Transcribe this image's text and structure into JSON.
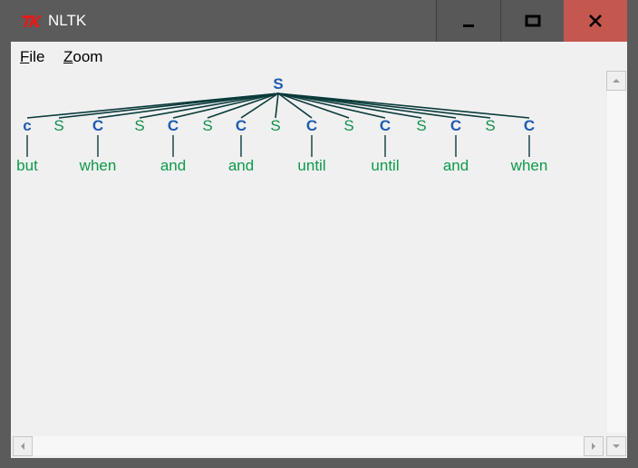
{
  "window": {
    "title": "NLTK",
    "title_color": "#ffffff",
    "titlebar_color": "#5b5b5b",
    "close_color": "#c4574e",
    "icons": [
      "tk-icon",
      "minimize-icon",
      "maximize-icon",
      "close-icon"
    ]
  },
  "menu": {
    "file_first": "F",
    "file_rest": "ile",
    "zoom_first": "Z",
    "zoom_rest": "oom"
  },
  "tree": {
    "root": "S",
    "children": [
      {
        "label": "c",
        "style": "blue",
        "leaf": "but"
      },
      {
        "label": "S",
        "style": "green",
        "leaf": null
      },
      {
        "label": "C",
        "style": "blue",
        "leaf": "when"
      },
      {
        "label": "S",
        "style": "green",
        "leaf": null
      },
      {
        "label": "C",
        "style": "blue",
        "leaf": "and"
      },
      {
        "label": "S",
        "style": "green",
        "leaf": null
      },
      {
        "label": "C",
        "style": "blue",
        "leaf": "and"
      },
      {
        "label": "S",
        "style": "green",
        "leaf": null
      },
      {
        "label": "C",
        "style": "blue",
        "leaf": "until"
      },
      {
        "label": "S",
        "style": "green",
        "leaf": null
      },
      {
        "label": "C",
        "style": "blue",
        "leaf": "until"
      },
      {
        "label": "S",
        "style": "green",
        "leaf": null
      },
      {
        "label": "C",
        "style": "blue",
        "leaf": "and"
      },
      {
        "label": "S",
        "style": "green",
        "leaf": null
      },
      {
        "label": "C",
        "style": "blue",
        "leaf": "when"
      }
    ],
    "colors": {
      "blue": "#1e5bb2",
      "green": "#148f4d",
      "leaf": "#0e9a4a",
      "edge": "#0b3b3b"
    }
  }
}
